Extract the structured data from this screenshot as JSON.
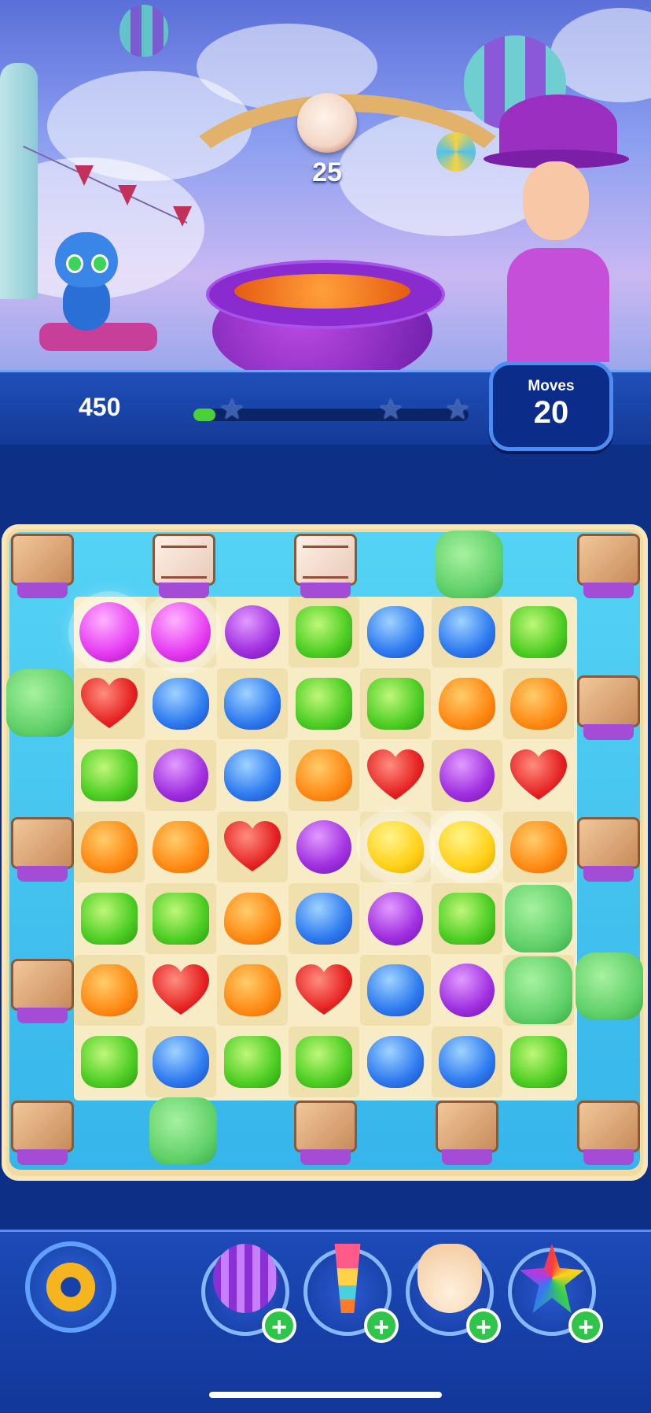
{
  "level_goal": {
    "icon": "frosted-cookie-icon",
    "remaining": "25"
  },
  "status": {
    "score": "450",
    "progress": 0.08,
    "moves_label": "Moves",
    "moves_value": "20"
  },
  "board": {
    "rows": [
      [
        "magenta-bomb",
        "magenta-bomb",
        "purple",
        "green",
        "blue",
        "blue",
        "green"
      ],
      [
        "red",
        "blue",
        "blue",
        "green",
        "green",
        "orange",
        "orange"
      ],
      [
        "green",
        "purple",
        "blue",
        "orange",
        "red",
        "purple",
        "red"
      ],
      [
        "orange",
        "orange",
        "red",
        "purple",
        "yellow-bomb",
        "yellow-bomb",
        "orange"
      ],
      [
        "green",
        "green",
        "orange",
        "blue",
        "purple",
        "green",
        "jelly"
      ],
      [
        "orange",
        "red",
        "orange",
        "red",
        "blue",
        "purple",
        "jelly"
      ],
      [
        "green",
        "blue",
        "green",
        "green",
        "blue",
        "blue",
        "green"
      ]
    ]
  },
  "boosters": [
    {
      "name": "striped-candy-booster",
      "badge": "+"
    },
    {
      "name": "ice-cream-booster",
      "badge": "+"
    },
    {
      "name": "hand-booster",
      "badge": "+"
    },
    {
      "name": "color-bomb-booster",
      "badge": "+"
    }
  ],
  "colors": {
    "accent": "#4d8df2",
    "board": "#f3d9a2",
    "water": "#35b5ea"
  }
}
